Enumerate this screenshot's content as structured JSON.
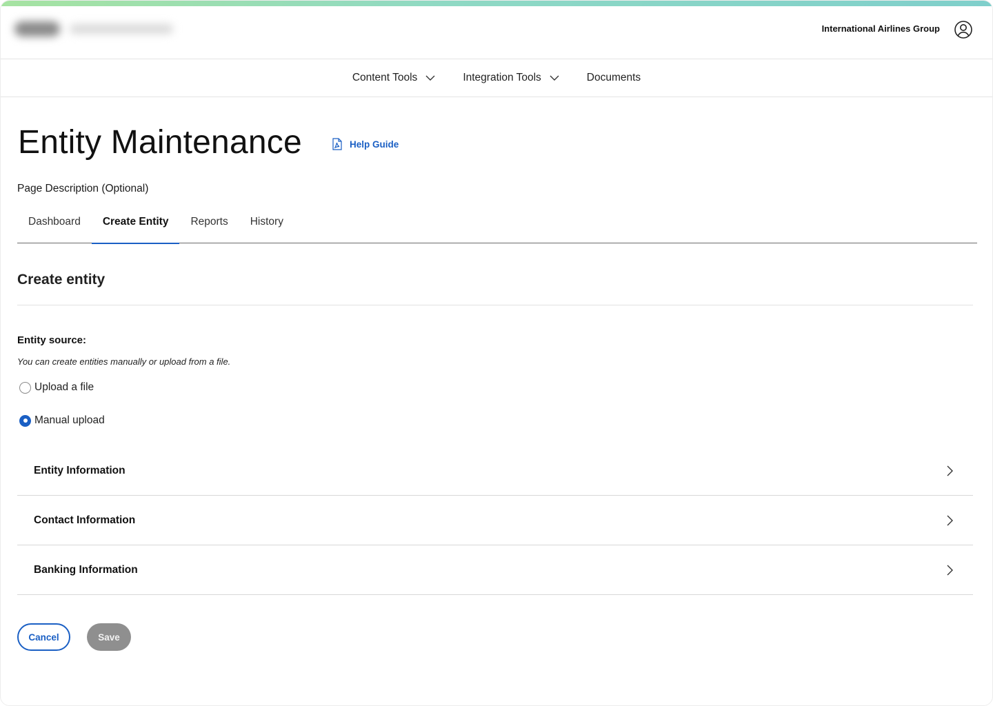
{
  "header": {
    "org_name": "International Airlines Group",
    "account_icon": "user-circle-icon"
  },
  "nav": {
    "items": [
      {
        "label": "Content Tools",
        "has_dropdown": true
      },
      {
        "label": "Integration Tools",
        "has_dropdown": true
      },
      {
        "label": "Documents",
        "has_dropdown": false
      }
    ]
  },
  "page": {
    "title": "Entity Maintenance",
    "help_link": "Help Guide",
    "help_icon": "pdf-document-icon",
    "description": "Page Description (Optional)"
  },
  "tabs": [
    {
      "label": "Dashboard",
      "active": false
    },
    {
      "label": "Create Entity",
      "active": true
    },
    {
      "label": "Reports",
      "active": false
    },
    {
      "label": "History",
      "active": false
    }
  ],
  "form": {
    "section_title": "Create entity",
    "source_label": "Entity source:",
    "source_help": "You can create entities manually or upload from a file.",
    "options": [
      {
        "label": "Upload a file",
        "selected": false
      },
      {
        "label": "Manual upload",
        "selected": true
      }
    ],
    "accordion": [
      {
        "label": "Entity Information"
      },
      {
        "label": "Contact Information"
      },
      {
        "label": "Banking Information"
      }
    ],
    "cancel_label": "Cancel",
    "save_label": "Save"
  },
  "colors": {
    "accent": "#1a5fc4",
    "disabled_button": "#8f8f8f"
  }
}
